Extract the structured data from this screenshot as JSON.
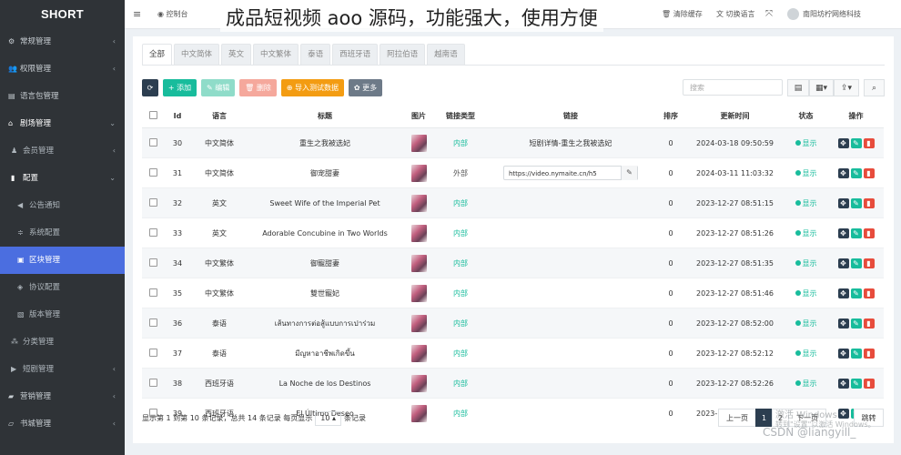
{
  "sidebar": {
    "brand": "SHORT",
    "items": [
      {
        "label": "常规管理",
        "icon": "cogs-icon",
        "glyph": "⚙",
        "arrow": "‹",
        "level": 0
      },
      {
        "label": "权限管理",
        "icon": "group-icon",
        "glyph": "👥",
        "arrow": "‹",
        "level": 0
      },
      {
        "label": "语言包管理",
        "icon": "language-icon",
        "glyph": "▤",
        "arrow": "",
        "level": 0
      },
      {
        "label": "剧场管理",
        "icon": "home-icon",
        "glyph": "⌂",
        "arrow": "⌄",
        "level": 0,
        "open": true
      },
      {
        "label": "会员管理",
        "icon": "user-icon",
        "glyph": "♟",
        "arrow": "‹",
        "level": 1
      },
      {
        "label": "配置",
        "icon": "file-icon",
        "glyph": "▮",
        "arrow": "⌄",
        "level": 1,
        "open": true
      },
      {
        "label": "公告通知",
        "icon": "bullhorn-icon",
        "glyph": "◀",
        "arrow": "",
        "level": 2
      },
      {
        "label": "系统配置",
        "icon": "sliders-icon",
        "glyph": "≑",
        "arrow": "",
        "level": 2
      },
      {
        "label": "区块管理",
        "icon": "image-icon",
        "glyph": "▣",
        "arrow": "",
        "level": 2,
        "active": true
      },
      {
        "label": "协议配置",
        "icon": "shield-icon",
        "glyph": "◈",
        "arrow": "",
        "level": 2
      },
      {
        "label": "版本管理",
        "icon": "picture-icon",
        "glyph": "▧",
        "arrow": "",
        "level": 2
      },
      {
        "label": "分类管理",
        "icon": "sitemap-icon",
        "glyph": "⁂",
        "arrow": "",
        "level": 1
      },
      {
        "label": "短剧管理",
        "icon": "video-icon",
        "glyph": "▶",
        "arrow": "‹",
        "level": 1
      },
      {
        "label": "营销管理",
        "icon": "briefcase-icon",
        "glyph": "▰",
        "arrow": "‹",
        "level": 0
      },
      {
        "label": "书城管理",
        "icon": "book-icon",
        "glyph": "▱",
        "arrow": "‹",
        "level": 0
      }
    ]
  },
  "topbar": {
    "menu_icon": "≡",
    "dashboard": "控制台",
    "frontend": "前台",
    "cache": "清除缓存",
    "language": "切换语言",
    "fullscreen": "⤧",
    "user": "南阳坊柠网络科技"
  },
  "overlay_caption": "成品短视频 aoo 源码，功能强大，使用方便",
  "tabs": [
    "全部",
    "中文简体",
    "英文",
    "中文繁体",
    "泰语",
    "西班牙语",
    "阿拉伯语",
    "越南语"
  ],
  "toolbar": {
    "refresh": "⟳",
    "add": "+ 添加",
    "edit": "✎ 编辑",
    "delete": "🗑 删除",
    "import": "⊕ 导入测试数据",
    "more": "✿ 更多"
  },
  "search": {
    "placeholder": "搜索"
  },
  "columns": [
    "",
    "Id",
    "语言",
    "标题",
    "图片",
    "链接类型",
    "链接",
    "排序",
    "更新时间",
    "状态",
    "操作"
  ],
  "rows": [
    {
      "id": "30",
      "lang": "中文简体",
      "title": "重生之我被选妃",
      "type": "内部",
      "internal": true,
      "link": "短剧详情-重生之我被选妃",
      "link_kind": "text",
      "sort": "0",
      "time": "2024-03-18 09:50:59",
      "status": "显示"
    },
    {
      "id": "31",
      "lang": "中文简体",
      "title": "御宠甜妻",
      "type": "外部",
      "internal": false,
      "link": "https://video.nymaite.cn/h5",
      "link_kind": "input",
      "sort": "0",
      "time": "2024-03-11 11:03:32",
      "status": "显示"
    },
    {
      "id": "32",
      "lang": "英文",
      "title": "Sweet Wife of the Imperial Pet",
      "type": "内部",
      "internal": true,
      "link": "",
      "link_kind": "text",
      "sort": "0",
      "time": "2023-12-27 08:51:15",
      "status": "显示"
    },
    {
      "id": "33",
      "lang": "英文",
      "title": "Adorable Concubine in Two Worlds",
      "type": "内部",
      "internal": true,
      "link": "",
      "link_kind": "text",
      "sort": "0",
      "time": "2023-12-27 08:51:26",
      "status": "显示"
    },
    {
      "id": "34",
      "lang": "中文繁体",
      "title": "御寵甜妻",
      "type": "内部",
      "internal": true,
      "link": "",
      "link_kind": "text",
      "sort": "0",
      "time": "2023-12-27 08:51:35",
      "status": "显示"
    },
    {
      "id": "35",
      "lang": "中文繁体",
      "title": "雙世寵妃",
      "type": "内部",
      "internal": true,
      "link": "",
      "link_kind": "text",
      "sort": "0",
      "time": "2023-12-27 08:51:46",
      "status": "显示"
    },
    {
      "id": "36",
      "lang": "泰语",
      "title": "เส้นทางการต่อสู้แบบการเปาร่วม",
      "type": "内部",
      "internal": true,
      "link": "",
      "link_kind": "text",
      "sort": "0",
      "time": "2023-12-27 08:52:00",
      "status": "显示"
    },
    {
      "id": "37",
      "lang": "泰语",
      "title": "มีญหาอาชีพเกิดขึ้น",
      "type": "内部",
      "internal": true,
      "link": "",
      "link_kind": "text",
      "sort": "0",
      "time": "2023-12-27 08:52:12",
      "status": "显示"
    },
    {
      "id": "38",
      "lang": "西班牙语",
      "title": "La Noche de los Destinos",
      "type": "内部",
      "internal": true,
      "link": "",
      "link_kind": "text",
      "sort": "0",
      "time": "2023-12-27 08:52:26",
      "status": "显示"
    },
    {
      "id": "39",
      "lang": "西班牙语",
      "title": "El Último Deseo",
      "type": "内部",
      "internal": true,
      "link": "",
      "link_kind": "text",
      "sort": "0",
      "time": "2023-12-27 08:52:43",
      "status": "显示"
    }
  ],
  "footer": {
    "info_prefix": "显示第 1 到第 10 条记录，总共 14 条记录 每页显示",
    "page_size": "10 ▴",
    "info_suffix": "条记录"
  },
  "pagination": [
    "上一页",
    "1",
    "2",
    "下一页",
    "跳转"
  ],
  "watermarks": {
    "activate_line1": "激活 Windows",
    "activate_line2": "转到\"设置\"以激活 Windows。",
    "csdn": "CSDN @liangyill_"
  },
  "chart_data": {
    "type": "table",
    "columns": [
      "Id",
      "语言",
      "标题",
      "链接类型",
      "链接",
      "排序",
      "更新时间",
      "状态"
    ],
    "rows": [
      [
        "30",
        "中文简体",
        "重生之我被选妃",
        "内部",
        "短剧详情-重生之我被选妃",
        "0",
        "2024-03-18 09:50:59",
        "显示"
      ],
      [
        "31",
        "中文简体",
        "御宠甜妻",
        "外部",
        "https://video.nymaite.cn/h5",
        "0",
        "2024-03-11 11:03:32",
        "显示"
      ],
      [
        "32",
        "英文",
        "Sweet Wife of the Imperial Pet",
        "内部",
        "",
        "0",
        "2023-12-27 08:51:15",
        "显示"
      ],
      [
        "33",
        "英文",
        "Adorable Concubine in Two Worlds",
        "内部",
        "",
        "0",
        "2023-12-27 08:51:26",
        "显示"
      ],
      [
        "34",
        "中文繁体",
        "御寵甜妻",
        "内部",
        "",
        "0",
        "2023-12-27 08:51:35",
        "显示"
      ],
      [
        "35",
        "中文繁体",
        "雙世寵妃",
        "内部",
        "",
        "0",
        "2023-12-27 08:51:46",
        "显示"
      ],
      [
        "36",
        "泰语",
        "เส้นทางการต่อสู้แบบการเปาร่วม",
        "内部",
        "",
        "0",
        "2023-12-27 08:52:00",
        "显示"
      ],
      [
        "37",
        "泰语",
        "มีญหาอาชีพเกิดขึ้น",
        "内部",
        "",
        "0",
        "2023-12-27 08:52:12",
        "显示"
      ],
      [
        "38",
        "西班牙语",
        "La Noche de los Destinos",
        "内部",
        "",
        "0",
        "2023-12-27 08:52:26",
        "显示"
      ],
      [
        "39",
        "西班牙语",
        "El Último Deseo",
        "内部",
        "",
        "0",
        "2023-12-27 08:52:43",
        "显示"
      ]
    ]
  }
}
